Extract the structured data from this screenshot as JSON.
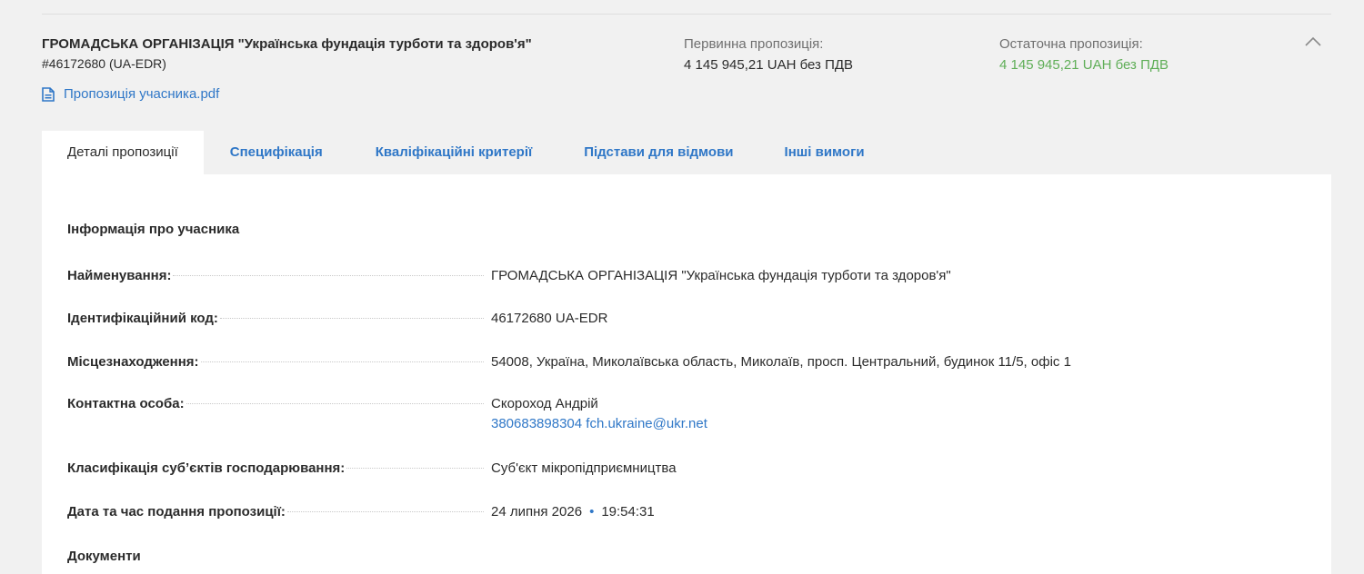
{
  "participant": {
    "name": "ГРОМАДСЬКА ОРГАНІЗАЦІЯ \"Українська фундація турботи та здоров'я\"",
    "id_line": "#46172680 (UA-EDR)",
    "pdf_label": "Пропозиція учасника.pdf"
  },
  "offers": {
    "initial_label": "Первинна пропозиція:",
    "initial_value": "4 145 945,21 UAH без ПДВ",
    "final_label": "Остаточна пропозиція:",
    "final_value": "4 145 945,21 UAH без ПДВ"
  },
  "tabs": [
    {
      "label": "Деталі пропозиції",
      "active": true
    },
    {
      "label": "Специфікація",
      "active": false
    },
    {
      "label": "Кваліфікаційні критерії",
      "active": false
    },
    {
      "label": "Підстави для відмови",
      "active": false
    },
    {
      "label": "Інші вимоги",
      "active": false
    }
  ],
  "details": {
    "section_title": "Інформація про учасника",
    "rows": [
      {
        "key": "Найменування:",
        "value": "ГРОМАДСЬКА ОРГАНІЗАЦІЯ \"Українська фундація турботи та здоров'я\""
      },
      {
        "key": "Ідентифікаційний код:",
        "value": "46172680 UA-EDR"
      },
      {
        "key": "Місцезнаходження:",
        "value": "54008, Україна, Миколаївська область, Миколаїв, просп. Центральний, будинок 11/5, офіс 1"
      },
      {
        "key": "Контактна особа:",
        "value": "Скороход Андрій",
        "contact_link": "380683898304 fch.ukraine@ukr.net"
      },
      {
        "key": "Класифікація суб’єктів господарювання:",
        "value": "Суб'єкт мікропідприємництва"
      },
      {
        "key": "Дата та час подання пропозиції:",
        "date": "24 липня 2026",
        "bullet": "•",
        "time": "19:54:31"
      }
    ],
    "documents_title": "Документи"
  },
  "colors": {
    "link": "#2f77c7",
    "final_offer": "#5fae57",
    "page_bg": "#f1f1f1",
    "panel_bg": "#ffffff"
  },
  "icons": {
    "pdf": "document-icon",
    "collapse": "chevron-up-icon"
  }
}
